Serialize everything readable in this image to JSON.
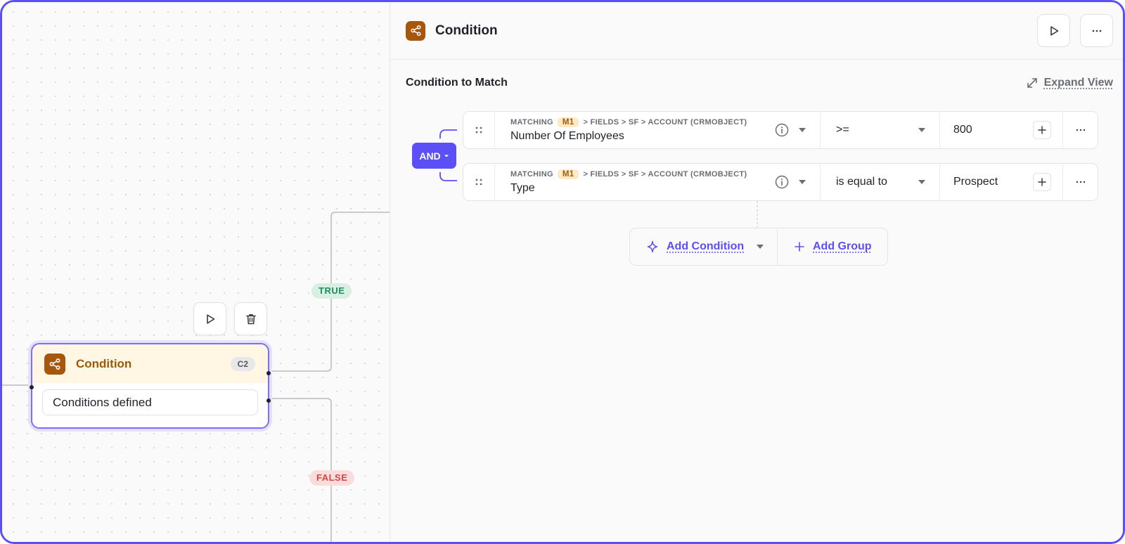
{
  "canvas": {
    "edge_true_label": "TRUE",
    "edge_false_label": "FALSE",
    "node": {
      "title": "Condition",
      "badge": "C2",
      "summary": "Conditions defined"
    }
  },
  "panel": {
    "title": "Condition",
    "section_title": "Condition to Match",
    "expand_label": "Expand View",
    "group_operator": "AND",
    "conditions": [
      {
        "prefix": "MATCHING",
        "badge": "M1",
        "path": "> FIELDS > SF > ACCOUNT (CRMOBJECT)",
        "field": "Number Of Employees",
        "operator": ">=",
        "value": "800"
      },
      {
        "prefix": "MATCHING",
        "badge": "M1",
        "path": "> FIELDS > SF > ACCOUNT (CRMOBJECT)",
        "field": "Type",
        "operator": "is equal to",
        "value": "Prospect"
      }
    ],
    "add_condition_label": "Add Condition",
    "add_group_label": "Add Group"
  },
  "colors": {
    "accent": "#5b4ff5",
    "condition_icon": "#a6570b",
    "true": "#238a5a",
    "false": "#d64545"
  },
  "icons": [
    "condition-icon",
    "play-icon",
    "trash-icon",
    "more-icon",
    "expand-icon",
    "drag-handle-icon",
    "info-icon",
    "chevron-down-icon",
    "plus-icon",
    "sparkle-icon"
  ]
}
